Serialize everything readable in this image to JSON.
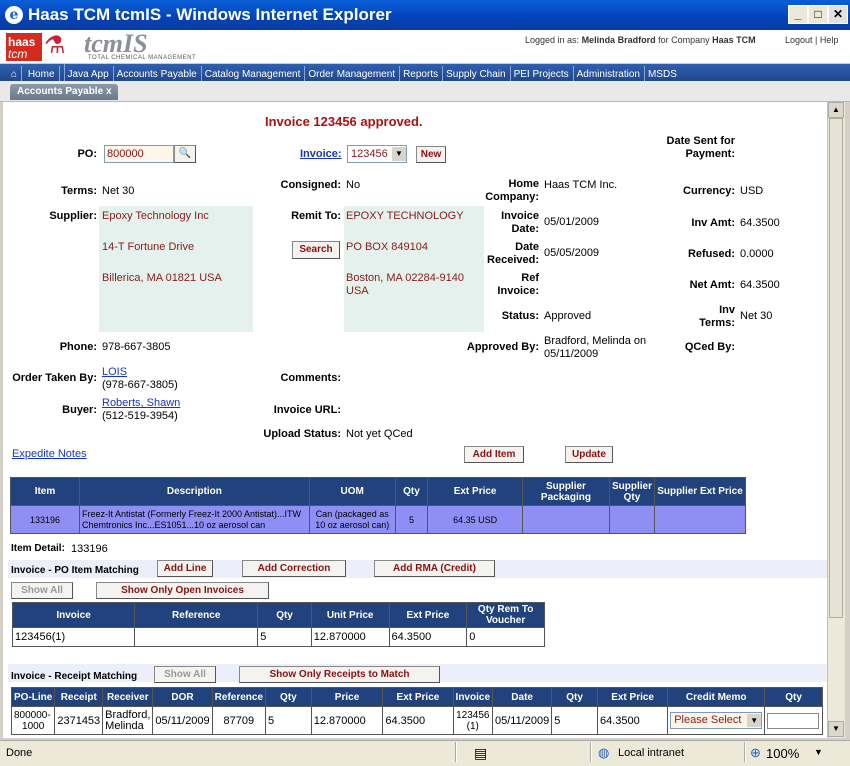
{
  "window": {
    "title": "Haas TCM tcmIS - Windows Internet Explorer"
  },
  "header": {
    "logo_top": "haas",
    "logo_bottom": "tcm",
    "brand": "tcmIS",
    "brand_sub": "TOTAL CHEMICAL MANAGEMENT",
    "login_prefix": "Logged in as:",
    "user": "Melinda Bradford",
    "company_prefix": "for Company",
    "company": "Haas TCM",
    "logout": "Logout",
    "help": "Help"
  },
  "nav": [
    "Home",
    "Java App",
    "Accounts Payable",
    "Catalog Management",
    "Order Management",
    "Reports",
    "Supply Chain",
    "PEI Projects",
    "Administration",
    "MSDS"
  ],
  "tab": {
    "label": "Accounts Payable",
    "close": "x"
  },
  "message": "Invoice 123456 approved.",
  "form": {
    "po_label": "PO:",
    "po_value": "800000",
    "invoice_label": "Invoice:",
    "invoice_value": "123456",
    "new_btn": "New",
    "date_sent_label": "Date Sent for Payment:",
    "terms_label": "Terms:",
    "terms_value": "Net 30",
    "consigned_label": "Consigned:",
    "consigned_value": "No",
    "home_company_label": "Home Company:",
    "home_company_value": "Haas TCM Inc.",
    "currency_label": "Currency:",
    "currency_value": "USD",
    "supplier_label": "Supplier:",
    "supplier_lines": [
      "Epoxy Technology Inc",
      "14-T Fortune Drive",
      "Billerica, MA 01821 USA"
    ],
    "remit_label": "Remit To:",
    "remit_lines": [
      "EPOXY TECHNOLOGY",
      "PO BOX 849104",
      "Boston, MA 02284-9140 USA"
    ],
    "search_btn": "Search",
    "invoice_date_label": "Invoice Date:",
    "invoice_date_value": "05/01/2009",
    "inv_amt_label": "Inv Amt:",
    "inv_amt_value": "64.3500",
    "date_received_label": "Date Received:",
    "date_received_value": "05/05/2009",
    "refused_label": "Refused:",
    "refused_value": "0.0000",
    "ref_invoice_label": "Ref Invoice:",
    "net_amt_label": "Net Amt:",
    "net_amt_value": "64.3500",
    "status_label": "Status:",
    "status_value": "Approved",
    "inv_terms_label": "Inv Terms:",
    "inv_terms_value": "Net 30",
    "phone_label": "Phone:",
    "phone_value": "978-667-3805",
    "approved_by_label": "Approved By:",
    "approved_by_value": "Bradford, Melinda on 05/11/2009",
    "qced_by_label": "QCed By:",
    "order_taken_label": "Order Taken By:",
    "order_taken_name": "LOIS",
    "order_taken_phone": "(978-667-3805)",
    "comments_label": "Comments:",
    "buyer_label": "Buyer:",
    "buyer_name": "Roberts, Shawn",
    "buyer_phone": "(512-519-3954)",
    "invoice_url_label": "Invoice URL:",
    "upload_status_label": "Upload Status:",
    "upload_status_value": "Not yet QCed"
  },
  "expedite_notes": "Expedite Notes",
  "add_item_btn": "Add Item",
  "update_btn": "Update",
  "items_table": {
    "headers": [
      "Item",
      "Description",
      "UOM",
      "Qty",
      "Ext Price",
      "Supplier Packaging",
      "Supplier Qty",
      "Supplier Ext Price"
    ],
    "row": {
      "item": "133196",
      "desc1": "Freez-It Antistat (Formerly Freez-It 2000 Antistat)...ITW",
      "desc2": "Chemtronics Inc...ES1051...10 oz aerosol can",
      "uom1": "Can (packaged as",
      "uom2": "10 oz aerosol can)",
      "qty": "5",
      "ext_price": "64.35 USD",
      "sup_pack": "",
      "sup_qty": "",
      "sup_ext": ""
    }
  },
  "item_detail": {
    "label": "Item Detail:",
    "value": "133196"
  },
  "po_matching": {
    "title": "Invoice - PO Item Matching",
    "add_line": "Add Line",
    "add_correction": "Add Correction",
    "add_rma": "Add RMA (Credit)",
    "show_all": "Show All",
    "show_open": "Show Only Open Invoices",
    "headers": [
      "Invoice",
      "Reference",
      "Qty",
      "Unit Price",
      "Ext Price",
      "Qty Rem To Voucher"
    ],
    "row": [
      "123456(1)",
      "",
      "5",
      "12.870000",
      "64.3500",
      "0"
    ]
  },
  "receipt_matching": {
    "title": "Invoice - Receipt Matching",
    "show_all": "Show All",
    "show_receipts": "Show Only Receipts to Match",
    "headers": [
      "PO-Line",
      "Receipt",
      "Receiver",
      "DOR",
      "Reference",
      "Qty",
      "Price",
      "Ext Price",
      "Invoice",
      "Date",
      "Qty",
      "Ext Price",
      "Credit Memo",
      "Qty"
    ],
    "row": {
      "po_line1": "800000-",
      "po_line2": "1000",
      "receipt": "2371453",
      "receiver1": "Bradford,",
      "receiver2": "Melinda",
      "dor": "05/11/2009",
      "reference": "87709",
      "qty": "5",
      "price": "12.870000",
      "ext_price": "64.3500",
      "invoice1": "123456",
      "invoice2": "(1)",
      "date": "05/11/2009",
      "qty2": "5",
      "ext_price2": "64.3500",
      "credit_memo": "Please Select",
      "qty3": ""
    }
  },
  "status": {
    "left": "Done",
    "zone": "Local intranet",
    "zoom": "100%"
  }
}
